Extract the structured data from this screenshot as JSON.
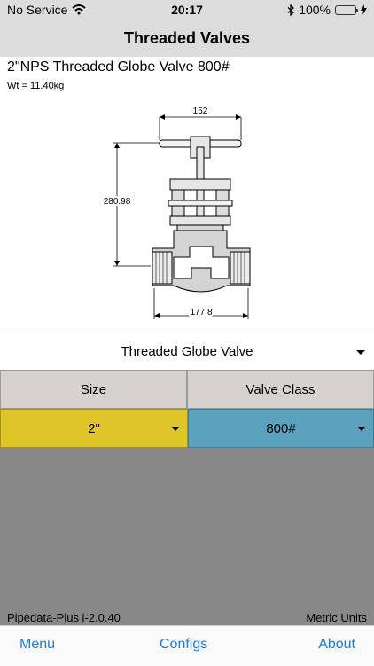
{
  "status_bar": {
    "carrier": "No Service",
    "time": "20:17",
    "battery_percent": "100%",
    "icons": [
      "wifi-icon",
      "bluetooth-icon",
      "battery-icon",
      "charging-icon"
    ]
  },
  "nav": {
    "title": "Threaded Valves"
  },
  "product": {
    "title": "2\"NPS Threaded Globe Valve 800#",
    "weight": "Wt = 11.40kg"
  },
  "drawing": {
    "width_dim": "152",
    "height_dim": "280.98",
    "length_dim": "177.8"
  },
  "valve_type": {
    "value": "Threaded Globe Valve"
  },
  "grid": {
    "size_header": "Size",
    "class_header": "Valve Class",
    "size_value": "2\"",
    "class_value": "800#"
  },
  "colors": {
    "size_bg": "#e0c528",
    "class_bg": "#5ba2bf",
    "tab_tint": "#1a7bdc"
  },
  "footer": {
    "version": "Pipedata-Plus i-2.0.40",
    "units": "Metric Units"
  },
  "tabs": {
    "menu": "Menu",
    "configs": "Configs",
    "about": "About"
  }
}
